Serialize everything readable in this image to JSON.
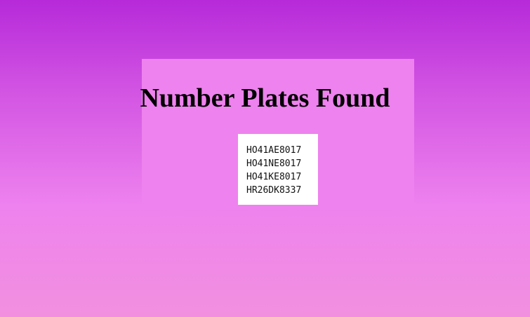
{
  "page": {
    "title": "Number Plates Found"
  },
  "plates": [
    "HO41AE8017",
    "HO41NE8017",
    "HO41KE8017",
    "HR26DK8337"
  ],
  "colors": {
    "background_top": "#b62ad9",
    "background_bottom": "#f290df",
    "panel": "#ee82ee",
    "plates_box": "#ffffff",
    "text": "#000000"
  }
}
